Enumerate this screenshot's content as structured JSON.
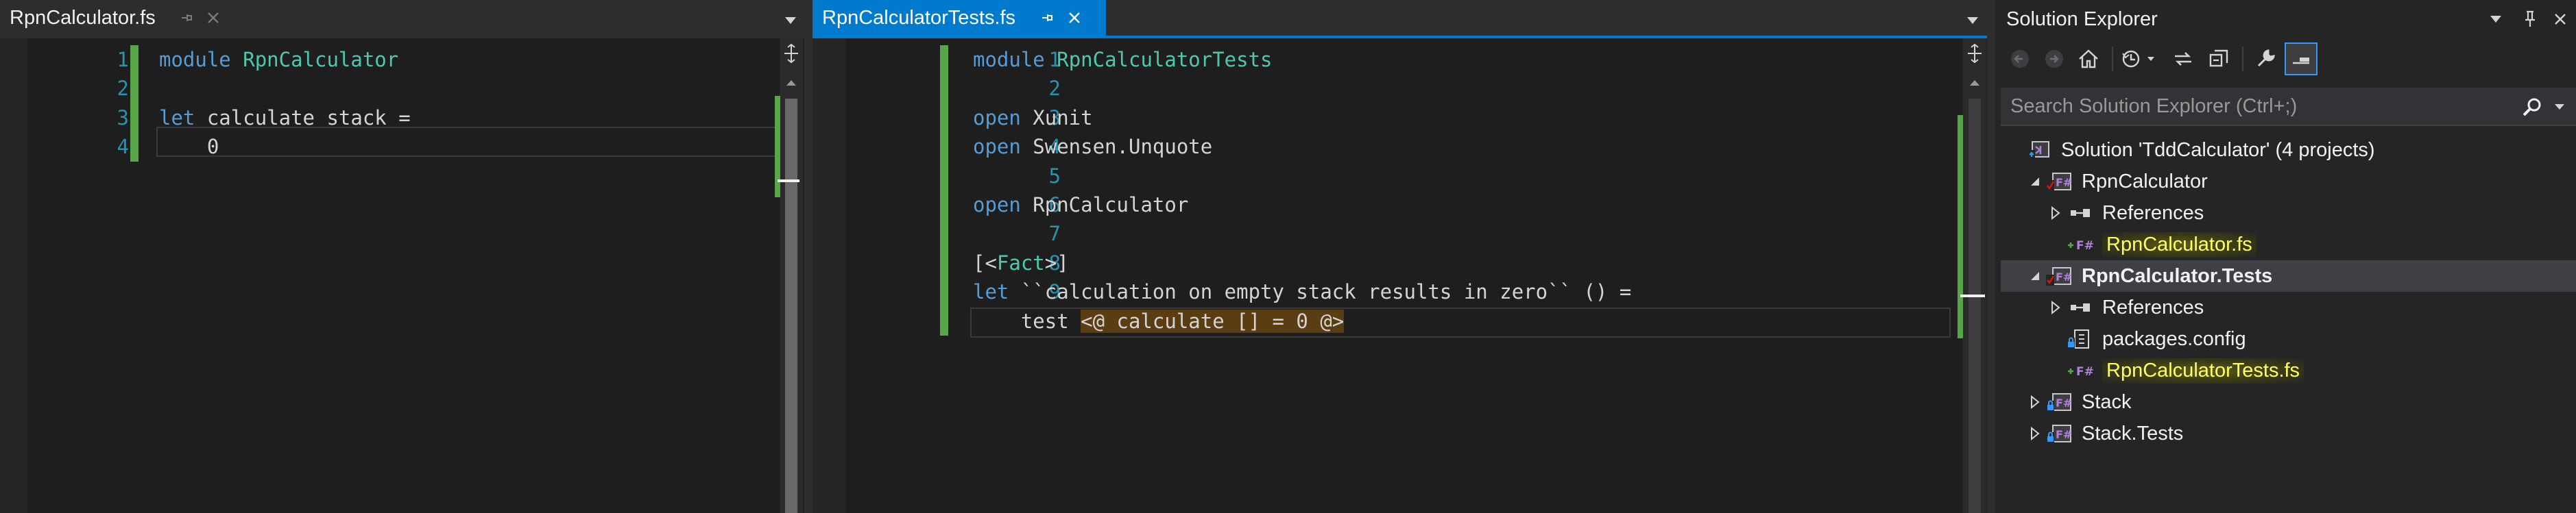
{
  "colors": {
    "accent": "#007acc",
    "change_bar": "#57a64a",
    "fsharp_icon": "#b180d7",
    "highlight_yellow": "#ffff66"
  },
  "left_editor": {
    "tab": {
      "title": "RpnCalculator.fs",
      "pin_icon": "pin-icon",
      "close_icon": "close-icon"
    },
    "lines": [
      {
        "num": "1",
        "tokens": [
          {
            "t": "module",
            "c": "kw"
          },
          {
            "t": " "
          },
          {
            "t": "RpnCalculator",
            "c": "ty"
          }
        ]
      },
      {
        "num": "2",
        "tokens": []
      },
      {
        "num": "3",
        "tokens": [
          {
            "t": "let",
            "c": "kw"
          },
          {
            "t": " calculate stack ="
          }
        ]
      },
      {
        "num": "4",
        "tokens": [
          {
            "t": "    0"
          }
        ]
      }
    ]
  },
  "right_editor": {
    "tab": {
      "title": "RpnCalculatorTests.fs",
      "pin_icon": "pin-icon",
      "close_icon": "close-icon"
    },
    "lines": [
      {
        "num": "1",
        "tokens": [
          {
            "t": "module",
            "c": "kw"
          },
          {
            "t": " "
          },
          {
            "t": "RpnCalculatorTests",
            "c": "ty"
          }
        ]
      },
      {
        "num": "2",
        "tokens": []
      },
      {
        "num": "3",
        "tokens": [
          {
            "t": "open",
            "c": "kw"
          },
          {
            "t": " Xunit"
          }
        ]
      },
      {
        "num": "4",
        "tokens": [
          {
            "t": "open",
            "c": "kw"
          },
          {
            "t": " Swensen.Unquote"
          }
        ]
      },
      {
        "num": "5",
        "tokens": []
      },
      {
        "num": "6",
        "tokens": [
          {
            "t": "open",
            "c": "kw"
          },
          {
            "t": " RpnCalculator"
          }
        ]
      },
      {
        "num": "7",
        "tokens": []
      },
      {
        "num": "8",
        "tokens": [
          {
            "t": "[<"
          },
          {
            "t": "Fact",
            "c": "ty"
          },
          {
            "t": ">]"
          }
        ]
      },
      {
        "num": "9",
        "tokens": [
          {
            "t": "let",
            "c": "kw"
          },
          {
            "t": " ``calculation on empty stack results in zero`` () ="
          }
        ]
      },
      {
        "num": "10",
        "tokens": [
          {
            "t": "    test "
          },
          {
            "t": "<@ calculate [] = 0 @>",
            "c": "quote-hl"
          }
        ]
      }
    ]
  },
  "solution_explorer": {
    "title": "Solution Explorer",
    "search_placeholder": "Search Solution Explorer (Ctrl+;)",
    "toolbar_icons": [
      "back-icon",
      "forward-icon",
      "home-icon",
      "history-icon",
      "sync-icon",
      "collapse-all-icon",
      "properties-icon",
      "preview-icon"
    ],
    "tree": [
      {
        "label": "Solution 'TddCalculator' (4 projects)",
        "icon": "solution-icon",
        "indent": 0,
        "expander": ""
      },
      {
        "label": "RpnCalculator",
        "icon": "fsharp-project-icon",
        "indent": 1,
        "expander": "expanded"
      },
      {
        "label": "References",
        "icon": "references-icon",
        "indent": 2,
        "expander": "collapsed"
      },
      {
        "label": "RpnCalculator.fs",
        "icon": "fsharp-file-icon",
        "indent": 2,
        "expander": "",
        "highlight": true
      },
      {
        "label": "RpnCalculator.Tests",
        "icon": "fsharp-project-icon",
        "indent": 1,
        "expander": "expanded",
        "selected": true,
        "bold": true
      },
      {
        "label": "References",
        "icon": "references-icon",
        "indent": 2,
        "expander": "collapsed"
      },
      {
        "label": "packages.config",
        "icon": "config-file-icon",
        "indent": 2,
        "expander": ""
      },
      {
        "label": "RpnCalculatorTests.fs",
        "icon": "fsharp-file-icon",
        "indent": 2,
        "expander": "",
        "highlight": true
      },
      {
        "label": "Stack",
        "icon": "fsharp-project-icon",
        "indent": 1,
        "expander": "collapsed"
      },
      {
        "label": "Stack.Tests",
        "icon": "fsharp-project-icon",
        "indent": 1,
        "expander": "collapsed"
      }
    ]
  }
}
